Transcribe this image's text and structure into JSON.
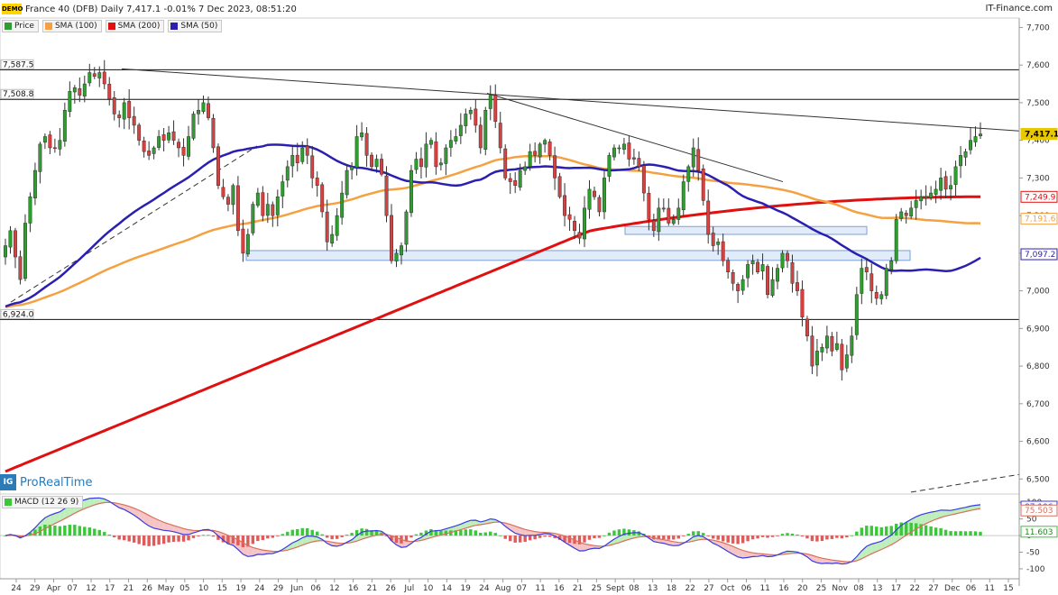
{
  "header": {
    "title": "France 40 (DFB) Daily 7,417.1 -0.01% 7 Dec 2023, 08:51:20",
    "brand": "IT-Finance.com",
    "demo_label": "DEMO"
  },
  "legend": [
    {
      "label": "Price",
      "color": "#2e9e2e"
    },
    {
      "label": "SMA (100)",
      "color": "#f5a142"
    },
    {
      "label": "SMA (200)",
      "color": "#e01010"
    },
    {
      "label": "SMA (50)",
      "color": "#2a1fb0"
    }
  ],
  "watermark": {
    "icon": "IG",
    "text": "ProRealTime"
  },
  "colors": {
    "up": "#2e9e2e",
    "down": "#d94040",
    "sma100": "#f5a142",
    "sma200": "#e01010",
    "sma50": "#2a1fb0",
    "macd": "#3a3ae0",
    "signal": "#d9705a",
    "hist": "#38c838",
    "hist_neg": "#e05a5a",
    "zone": "#c9dcf3"
  },
  "chart_data": [
    {
      "type": "candlestick",
      "title": "France 40 (DFB) Daily",
      "y_ticks": [
        "7,700",
        "7,600",
        "7,500",
        "7,400",
        "7,300",
        "7,200",
        "7,100",
        "7,000",
        "6,900",
        "6,800",
        "6,700",
        "6,600",
        "6,500"
      ],
      "ylim": [
        6460,
        7725
      ],
      "x_labels": [
        "24",
        "29",
        "Apr",
        "07",
        "12",
        "17",
        "21",
        "26",
        "May",
        "05",
        "10",
        "15",
        "19",
        "24",
        "29",
        "Jun",
        "06",
        "12",
        "16",
        "21",
        "26",
        "Jul",
        "10",
        "14",
        "19",
        "24",
        "Aug",
        "07",
        "11",
        "16",
        "21",
        "25",
        "Sept",
        "08",
        "13",
        "18",
        "22",
        "27",
        "Oct",
        "06",
        "11",
        "16",
        "20",
        "25",
        "Nov",
        "08",
        "13",
        "17",
        "22",
        "27",
        "Dec",
        "06",
        "11",
        "15"
      ],
      "levels": [
        {
          "label": "7,587.5",
          "value": 7587.5
        },
        {
          "label": "7,508.8",
          "value": 7508.8
        },
        {
          "label": "6,924.0",
          "value": 6924.0
        }
      ],
      "badges": [
        {
          "label": "7,417.1",
          "value": 7417.1,
          "color": "#e8c800",
          "text_color": "#000"
        },
        {
          "label": "7,249.9",
          "value": 7249.9,
          "color": "#e01010",
          "text_color": "#e01010"
        },
        {
          "label": "7,191.6",
          "value": 7191.6,
          "color": "#f5a142",
          "text_color": "#f5a142"
        },
        {
          "label": "7,097.2",
          "value": 7097.2,
          "color": "#2a1fb0",
          "text_color": "#2a1fb0"
        }
      ],
      "closes": [
        7120,
        7160,
        7090,
        7030,
        7180,
        7250,
        7320,
        7390,
        7410,
        7380,
        7380,
        7400,
        7480,
        7530,
        7540,
        7520,
        7550,
        7580,
        7570,
        7580,
        7550,
        7510,
        7470,
        7460,
        7500,
        7460,
        7440,
        7400,
        7370,
        7360,
        7380,
        7410,
        7400,
        7420,
        7400,
        7380,
        7360,
        7410,
        7470,
        7480,
        7500,
        7460,
        7380,
        7280,
        7250,
        7230,
        7280,
        7160,
        7100,
        7150,
        7230,
        7260,
        7200,
        7230,
        7200,
        7250,
        7290,
        7330,
        7360,
        7340,
        7380,
        7360,
        7300,
        7280,
        7210,
        7130,
        7150,
        7200,
        7260,
        7320,
        7330,
        7410,
        7420,
        7360,
        7330,
        7350,
        7310,
        7200,
        7080,
        7100,
        7120,
        7210,
        7320,
        7350,
        7330,
        7390,
        7400,
        7330,
        7340,
        7380,
        7400,
        7410,
        7440,
        7470,
        7480,
        7440,
        7380,
        7480,
        7520,
        7450,
        7380,
        7300,
        7290,
        7280,
        7320,
        7330,
        7370,
        7360,
        7390,
        7400,
        7360,
        7300,
        7250,
        7200,
        7190,
        7160,
        7140,
        7220,
        7270,
        7250,
        7210,
        7300,
        7360,
        7380,
        7380,
        7390,
        7350,
        7350,
        7330,
        7260,
        7190,
        7160,
        7220,
        7220,
        7180,
        7190,
        7220,
        7290,
        7330,
        7380,
        7320,
        7240,
        7150,
        7120,
        7130,
        7080,
        7050,
        7020,
        7000,
        7030,
        7070,
        7080,
        7050,
        7070,
        6990,
        7030,
        7060,
        7100,
        7080,
        7020,
        7000,
        6930,
        6880,
        6800,
        6840,
        6850,
        6880,
        6840,
        6860,
        6790,
        6830,
        6880,
        6990,
        7060,
        7050,
        7000,
        6980,
        6990,
        7060,
        7080,
        7190,
        7210,
        7200,
        7220,
        7240,
        7250,
        7250,
        7260,
        7270,
        7300,
        7270,
        7280,
        7330,
        7360,
        7370,
        7400,
        7410,
        7417
      ]
    },
    {
      "type": "macd",
      "title": "MACD (12 26 9)",
      "y_ticks": [
        "100",
        "50",
        "0",
        "-50",
        "-100"
      ],
      "ylim": [
        -130,
        125
      ],
      "badges": [
        {
          "label": "87.106",
          "value": 87.106,
          "color": "#3a3ae0",
          "text_color": "#3a3ae0"
        },
        {
          "label": "75.503",
          "value": 75.503,
          "color": "#d9705a",
          "text_color": "#d9705a"
        },
        {
          "label": "11.603",
          "value": 11.603,
          "color": "#38c838",
          "text_color": "#1a8a1a"
        }
      ]
    }
  ]
}
